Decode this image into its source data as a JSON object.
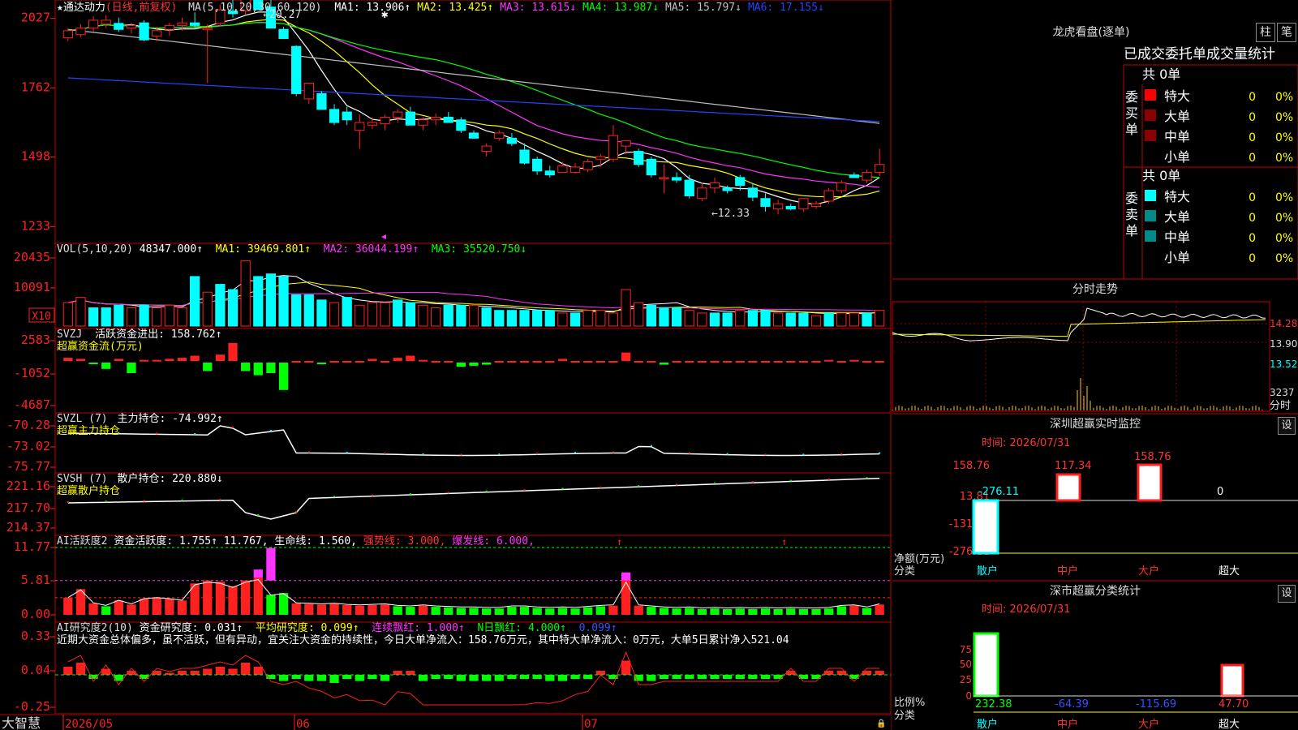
{
  "app": {
    "brand": "大智慧"
  },
  "chart": {
    "title": "★通达动力",
    "subtitle": "(日线,前复权)",
    "ma_label": "MA(5,10,20,30,60,120)",
    "ma_values": [
      {
        "text": "MA1: 13.906↑",
        "color": "#ffffff"
      },
      {
        "text": "MA2: 13.425↑",
        "color": "#ffff00"
      },
      {
        "text": "MA3: 13.615↓",
        "color": "#ff33ff"
      },
      {
        "text": "MA4: 13.987↓",
        "color": "#00ff00"
      },
      {
        "text": "MA5: 15.797↓",
        "color": "#c0c0c0"
      },
      {
        "text": "MA6: 17.155↓",
        "color": "#2244ff"
      }
    ],
    "high_mark": "20.27",
    "low_mark": "12.33",
    "price_ticks": [
      "2027",
      "1762",
      "1498",
      "1233"
    ],
    "vol": {
      "label": "VOL(5,10,20)",
      "value": "48347.000↑",
      "ma1": "MA1: 39469.801↑",
      "ma2": "MA2: 36044.199↑",
      "ma3": "MA3: 35520.750↓",
      "ticks": [
        "20435",
        "10091"
      ],
      "unit": "X10"
    },
    "svzj": {
      "label": "SVZJ",
      "desc": "活跃资金进出: 158.762↑",
      "title": "超赢资金流(万元)",
      "ticks": [
        "2583",
        "-1052",
        "-4687"
      ]
    },
    "svzl": {
      "label": "SVZL (7)",
      "desc": "主力持仓: -74.992↑",
      "title": "超赢主力持仓",
      "ticks": [
        "-70.28",
        "-73.02",
        "-75.77"
      ]
    },
    "svsh": {
      "label": "SVSH (7)",
      "desc": "散户持仓: 220.880↓",
      "title": "超赢散户持仓",
      "ticks": [
        "221.16",
        "217.70",
        "214.37"
      ]
    },
    "ai1": {
      "label": "AI活跃度2",
      "desc": "资金活跃度: 1.755↑",
      "v2": "11.767,",
      "v3": "生命线: 1.560,",
      "strong": "强势线: 3.000,",
      "burst": "爆发线: 6.000,",
      "ticks": [
        "11.77",
        "5.81",
        "0.00"
      ]
    },
    "ai2": {
      "label": "AI研究度2(10)",
      "desc": "资金研究度: 0.031↑",
      "avg": "平均研究度: 0.099↑",
      "red": "连续飘红: 1.000↑",
      "nred": "N日飘红: 4.000↑",
      "last": "0.099↑",
      "note": "近期大资金总体偏多，虽不活跃，但有异动，宜关注大资金的持续性，今日大单净流入：158.76万元，其中特大单净流入：0万元，大单5日累计净入521.04",
      "ticks": [
        "0.33",
        "0.04",
        "-0.25"
      ]
    },
    "dates": [
      "2026/05",
      "06",
      "07"
    ]
  },
  "candles": [
    [
      1953,
      1990,
      1940,
      1980
    ],
    [
      1965,
      2005,
      1955,
      1990
    ],
    [
      1990,
      2035,
      1975,
      2020
    ],
    [
      2005,
      2040,
      1990,
      2020
    ],
    [
      2008,
      2030,
      1975,
      1985
    ],
    [
      1990,
      2010,
      1970,
      2000
    ],
    [
      2010,
      2020,
      1940,
      1945
    ],
    [
      1960,
      1995,
      1940,
      1980
    ],
    [
      1985,
      2010,
      1960,
      2000
    ],
    [
      2000,
      2030,
      1980,
      2010
    ],
    [
      2010,
      2050,
      1990,
      2000
    ],
    [
      1985,
      2005,
      1780,
      1990
    ],
    [
      2008,
      2080,
      1995,
      2060
    ],
    [
      2055,
      2100,
      2030,
      2045
    ],
    [
      2055,
      2130,
      2040,
      2100
    ],
    [
      2110,
      2160,
      2060,
      2060
    ],
    [
      2070,
      2110,
      1990,
      1990
    ],
    [
      1985,
      1995,
      1950,
      1950
    ],
    [
      1920,
      1925,
      1730,
      1740
    ],
    [
      1720,
      1780,
      1700,
      1780
    ],
    [
      1740,
      1750,
      1680,
      1680
    ],
    [
      1680,
      1700,
      1620,
      1630
    ],
    [
      1670,
      1690,
      1620,
      1640
    ],
    [
      1600,
      1660,
      1530,
      1630
    ],
    [
      1620,
      1650,
      1605,
      1630
    ],
    [
      1625,
      1660,
      1600,
      1650
    ],
    [
      1650,
      1680,
      1630,
      1670
    ],
    [
      1670,
      1690,
      1620,
      1620
    ],
    [
      1620,
      1650,
      1600,
      1640
    ],
    [
      1640,
      1665,
      1620,
      1650
    ],
    [
      1650,
      1670,
      1630,
      1630
    ],
    [
      1640,
      1650,
      1590,
      1600
    ],
    [
      1590,
      1600,
      1570,
      1570
    ],
    [
      1520,
      1550,
      1500,
      1540
    ],
    [
      1570,
      1600,
      1560,
      1590
    ],
    [
      1570,
      1590,
      1540,
      1550
    ],
    [
      1525,
      1550,
      1470,
      1475
    ],
    [
      1490,
      1500,
      1430,
      1445
    ],
    [
      1445,
      1465,
      1420,
      1430
    ],
    [
      1440,
      1480,
      1440,
      1465
    ],
    [
      1440,
      1475,
      1435,
      1460
    ],
    [
      1450,
      1490,
      1440,
      1480
    ],
    [
      1490,
      1510,
      1460,
      1500
    ],
    [
      1490,
      1620,
      1480,
      1580
    ],
    [
      1540,
      1560,
      1510,
      1560
    ],
    [
      1520,
      1530,
      1460,
      1470
    ],
    [
      1490,
      1500,
      1420,
      1430
    ],
    [
      1420,
      1470,
      1360,
      1420
    ],
    [
      1420,
      1440,
      1400,
      1410
    ],
    [
      1410,
      1430,
      1340,
      1350
    ],
    [
      1340,
      1400,
      1330,
      1380
    ],
    [
      1380,
      1420,
      1360,
      1400
    ],
    [
      1380,
      1390,
      1360,
      1370
    ],
    [
      1420,
      1430,
      1370,
      1390
    ],
    [
      1380,
      1400,
      1330,
      1345
    ],
    [
      1340,
      1360,
      1290,
      1310
    ],
    [
      1300,
      1335,
      1280,
      1320
    ],
    [
      1310,
      1320,
      1295,
      1300
    ],
    [
      1300,
      1340,
      1290,
      1340
    ],
    [
      1310,
      1330,
      1300,
      1320
    ],
    [
      1330,
      1380,
      1320,
      1370
    ],
    [
      1370,
      1410,
      1360,
      1400
    ],
    [
      1430,
      1440,
      1420,
      1420
    ],
    [
      1410,
      1450,
      1400,
      1440
    ],
    [
      1440,
      1530,
      1425,
      1470
    ]
  ],
  "vol_data": [
    [
      9,
      1
    ],
    [
      11,
      1
    ],
    [
      7,
      0
    ],
    [
      7,
      0
    ],
    [
      8,
      0
    ],
    [
      7,
      1
    ],
    [
      8,
      0
    ],
    [
      7,
      1
    ],
    [
      8,
      1
    ],
    [
      7,
      1
    ],
    [
      19,
      0
    ],
    [
      13,
      1
    ],
    [
      16,
      0
    ],
    [
      14,
      0
    ],
    [
      25,
      1
    ],
    [
      19,
      0
    ],
    [
      20,
      0
    ],
    [
      19,
      0
    ],
    [
      12,
      0
    ],
    [
      12,
      0
    ],
    [
      10,
      0
    ],
    [
      9,
      1
    ],
    [
      11,
      0
    ],
    [
      8,
      1
    ],
    [
      9,
      1
    ],
    [
      9,
      1
    ],
    [
      10,
      0
    ],
    [
      9,
      0
    ],
    [
      8,
      1
    ],
    [
      7,
      1
    ],
    [
      8,
      0
    ],
    [
      8,
      0
    ],
    [
      8,
      1
    ],
    [
      7,
      0
    ],
    [
      6,
      0
    ],
    [
      6,
      0
    ],
    [
      6,
      0
    ],
    [
      6,
      0
    ],
    [
      6,
      0
    ],
    [
      5,
      1
    ],
    [
      5,
      0
    ],
    [
      6,
      1
    ],
    [
      6,
      1
    ],
    [
      5,
      1
    ],
    [
      14,
      1
    ],
    [
      9,
      1
    ],
    [
      8,
      0
    ],
    [
      7,
      0
    ],
    [
      7,
      0
    ],
    [
      6,
      1
    ],
    [
      5,
      1
    ],
    [
      5,
      0
    ],
    [
      5,
      0
    ],
    [
      6,
      1
    ],
    [
      6,
      0
    ],
    [
      6,
      0
    ],
    [
      5,
      1
    ],
    [
      5,
      0
    ],
    [
      5,
      0
    ],
    [
      4,
      1
    ],
    [
      5,
      0
    ],
    [
      5,
      1
    ],
    [
      5,
      1
    ],
    [
      5,
      0
    ],
    [
      6,
      1
    ]
  ],
  "ai1_data": [
    3.0,
    4.5,
    2.0,
    1.5,
    2.5,
    1.8,
    2.8,
    3.0,
    2.8,
    2.5,
    5.5,
    6.0,
    5.8,
    5.0,
    6.0,
    6.5,
    3.5,
    3.8,
    2.0,
    1.9,
    1.8,
    1.9,
    1.7,
    1.6,
    1.7,
    1.8,
    1.5,
    1.4,
    1.6,
    1.4,
    1.3,
    1.2,
    1.2,
    1.1,
    1.1,
    1.4,
    1.4,
    1.2,
    1.1,
    1.2,
    1.1,
    1.3,
    1.5,
    1.6,
    6.0,
    1.6,
    1.4,
    1.2,
    1.1,
    1.2,
    1.0,
    1.1,
    1.0,
    1.1,
    1.0,
    1.1,
    1.0,
    1.1,
    1.0,
    1.0,
    1.1,
    1.5,
    1.6,
    1.2,
    1.8
  ]
}
